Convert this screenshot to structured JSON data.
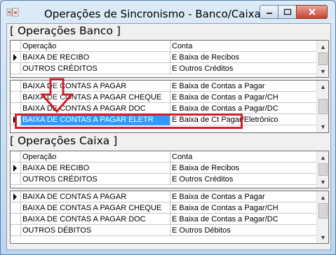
{
  "window": {
    "title": "Operações de Sincronismo - Banco/Caixa",
    "min_glyph": "—",
    "max_glyph": "▢",
    "close_glyph": "✕"
  },
  "banco": {
    "section_title": "[ Operações Banco ]",
    "header": {
      "col1": "Operação",
      "col2": "Conta"
    },
    "grid1_rows": [
      {
        "op": "BAIXA DE RECIBO",
        "conta": "E Baixa de Recibos",
        "current": true
      },
      {
        "op": "OUTROS CRÉDITOS",
        "conta": "E Outros Créditos",
        "current": false
      }
    ],
    "grid2_rows": [
      {
        "op": "BAIXA DE CONTAS A PAGAR",
        "conta": "E Baixa de Contas a Pagar",
        "current": false
      },
      {
        "op": "BAIXA DE CONTAS A PAGAR CHEQUE",
        "conta": "E Baixa de Contas a Pagar/CH",
        "current": false
      },
      {
        "op": "BAIXA DE CONTAS A PAGAR DOC",
        "conta": "E Baixa de Contas a Pagar/DC",
        "current": false
      },
      {
        "op": "BAIXA DE CONTAS A PAGAR ELETR",
        "conta": "E Baixa de Ct Pagar/Eletrônico",
        "current": true,
        "selected": true
      }
    ]
  },
  "caixa": {
    "section_title": "[ Operações Caixa ]",
    "header": {
      "col1": "Operação",
      "col2": "Conta"
    },
    "grid1_rows": [
      {
        "op": "BAIXA DE RECIBO",
        "conta": "E Baixa de Recibos",
        "current": true
      },
      {
        "op": "OUTROS CRÉDITOS",
        "conta": "E Outros Créditos",
        "current": false
      }
    ],
    "grid2_rows": [
      {
        "op": "BAIXA DE CONTAS A PAGAR",
        "conta": "E Baixa de Contas a Pagar",
        "current": true
      },
      {
        "op": "BAIXA DE CONTAS A PAGAR CHEQUE",
        "conta": "E Baixa de Contas a Pagar/CH",
        "current": false
      },
      {
        "op": "BAIXA DE CONTAS A PAGAR DOC",
        "conta": "E Baixa de Contas a Pagar/DC",
        "current": false
      },
      {
        "op": "OUTROS DÉBITOS",
        "conta": "E Outros Débitos",
        "current": false
      }
    ]
  },
  "colors": {
    "selection": "#3399ff",
    "annotation_red": "#d01f2a"
  },
  "icons": {
    "app": "app-icon",
    "scroll_up": "scroll-up-arrow-icon",
    "scroll_down": "scroll-down-arrow-icon",
    "row_pointer": "row-pointer-icon",
    "annotation_arrow": "annotation-down-arrow"
  }
}
